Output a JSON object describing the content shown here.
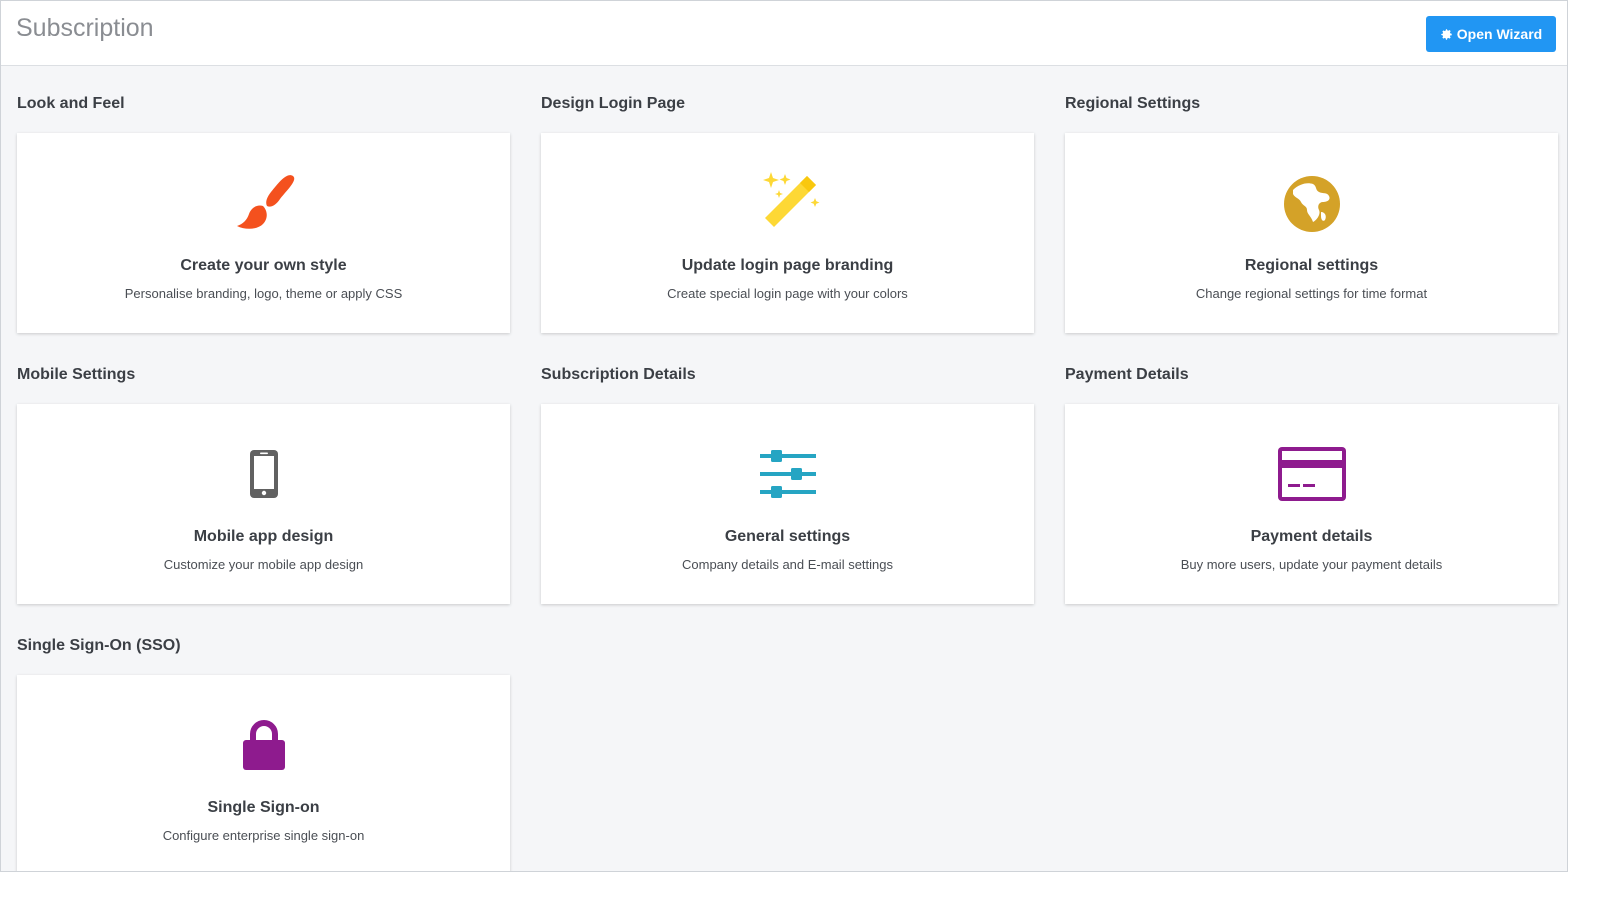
{
  "header": {
    "title": "Subscription",
    "wizard_button": "Open Wizard"
  },
  "sections": [
    {
      "title": "Look and Feel",
      "card_title": "Create your own style",
      "card_desc": "Personalise branding, logo, theme or apply CSS",
      "icon": "paintbrush-icon",
      "color": "#f4511e"
    },
    {
      "title": "Design Login Page",
      "card_title": "Update login page branding",
      "card_desc": "Create special login page with your colors",
      "icon": "magic-wand-icon",
      "color": "#fdd835"
    },
    {
      "title": "Regional Settings",
      "card_title": "Regional settings",
      "card_desc": "Change regional settings for time format",
      "icon": "globe-icon",
      "color": "#d4a228"
    },
    {
      "title": "Mobile Settings",
      "card_title": "Mobile app design",
      "card_desc": "Customize your mobile app design",
      "icon": "mobile-phone-icon",
      "color": "#616161"
    },
    {
      "title": "Subscription Details",
      "card_title": "General settings",
      "card_desc": "Company details and E-mail settings",
      "icon": "sliders-icon",
      "color": "#26a5c3"
    },
    {
      "title": "Payment Details",
      "card_title": "Payment details",
      "card_desc": "Buy more users, update your payment details",
      "icon": "credit-card-icon",
      "color": "#8e1b8e"
    },
    {
      "title": "Single Sign-On (SSO)",
      "card_title": "Single Sign-on",
      "card_desc": "Configure enterprise single sign-on",
      "icon": "lock-icon",
      "color": "#8e1b8e"
    }
  ]
}
